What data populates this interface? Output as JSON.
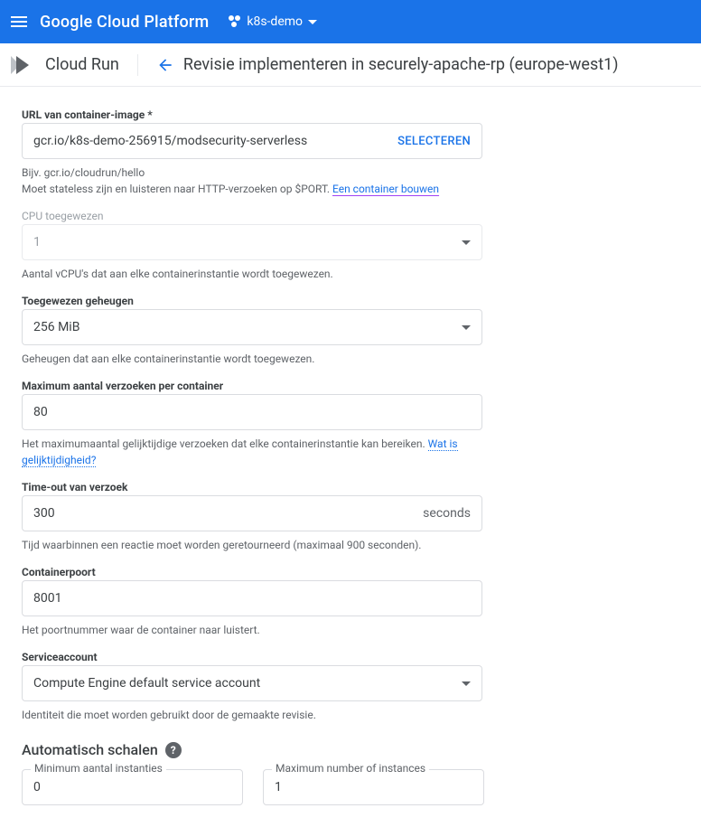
{
  "header": {
    "logo_text": "Google Cloud Platform",
    "project_name": "k8s-demo"
  },
  "subheader": {
    "product": "Cloud Run",
    "page_title": "Revisie implementeren in securely-apache-rp (europe-west1)"
  },
  "form": {
    "image": {
      "label": "URL van container-image *",
      "value": "gcr.io/k8s-demo-256915/modsecurity-serverless",
      "select_btn": "SELECTEREN",
      "helper1": "Bijv. gcr.io/cloudrun/hello",
      "helper2": "Moet stateless zijn en luisteren naar HTTP-verzoeken op $PORT. ",
      "helper2_link": "Een container bouwen"
    },
    "cpu": {
      "label": "CPU toegewezen",
      "value": "1",
      "helper": "Aantal vCPU's dat aan elke containerinstantie wordt toegewezen."
    },
    "memory": {
      "label": "Toegewezen geheugen",
      "value": "256 MiB",
      "helper": "Geheugen dat aan elke containerinstantie wordt toegewezen."
    },
    "concurrency": {
      "label": "Maximum aantal verzoeken per container",
      "value": "80",
      "helper": "Het maximumaantal gelijktijdige verzoeken dat elke containerinstantie kan bereiken. ",
      "helper_link": "Wat is gelijktijdigheid?"
    },
    "timeout": {
      "label": "Time-out van verzoek",
      "value": "300",
      "unit": "seconds",
      "helper": "Tijd waarbinnen een reactie moet worden geretourneerd (maximaal 900 seconden)."
    },
    "port": {
      "label": "Containerpoort",
      "value": "8001",
      "helper": "Het poortnummer waar de container naar luistert."
    },
    "serviceaccount": {
      "label": "Serviceaccount",
      "value": "Compute Engine default service account",
      "helper": "Identiteit die moet worden gebruikt door de gemaakte revisie."
    }
  },
  "autoscale": {
    "heading": "Automatisch schalen",
    "min_label": "Minimum aantal instanties",
    "min_value": "0",
    "max_label": "Maximum number of instances",
    "max_value": "1"
  }
}
